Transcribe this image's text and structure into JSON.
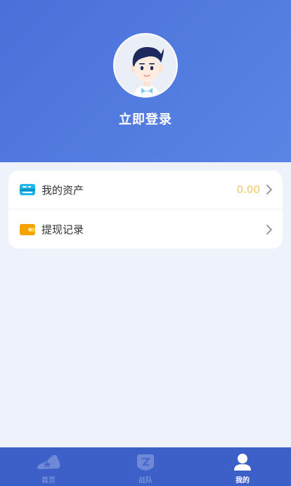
{
  "profile": {
    "login_label": "立即登录"
  },
  "menu": {
    "items": [
      {
        "label": "我的资产",
        "value": "0.00",
        "icon": "card-icon"
      },
      {
        "label": "提现记录",
        "value": "",
        "icon": "wallet-icon"
      }
    ]
  },
  "tabbar": {
    "tabs": [
      {
        "label": "首页",
        "icon": "sneaker-icon",
        "active": false
      },
      {
        "label": "战队",
        "icon": "team-shield-icon",
        "active": false
      },
      {
        "label": "我的",
        "icon": "user-icon",
        "active": true
      }
    ]
  },
  "colors": {
    "header": "#4a70d9",
    "tabbar": "#3d5fc8",
    "asset_value": "#f5c86a",
    "background": "#eef2fb"
  }
}
